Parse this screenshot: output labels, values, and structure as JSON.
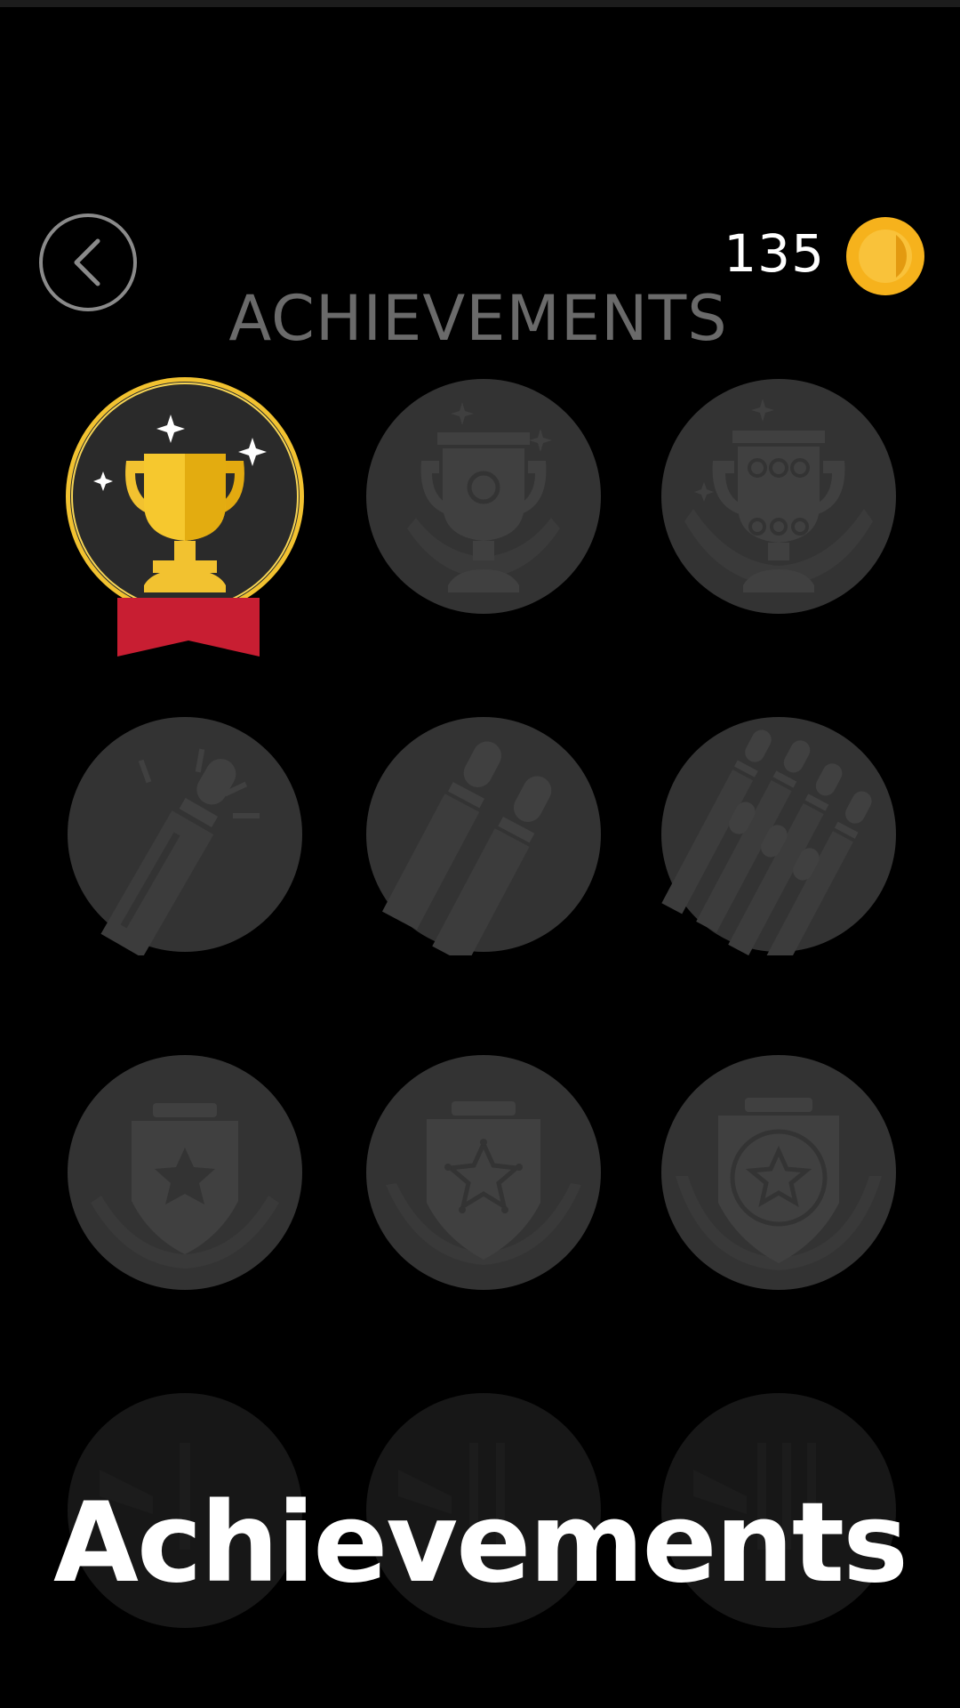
{
  "header": {
    "title": "ACHIEVEMENTS",
    "coins": "135",
    "back_icon": "chevron-left-icon",
    "coin_icon": "gold-coin-icon",
    "coin_color": "#f6b21c"
  },
  "achievements": [
    {
      "icon": "gold-trophy-icon",
      "state": "unlocked"
    },
    {
      "icon": "trophy-one-dot-icon",
      "state": "locked"
    },
    {
      "icon": "trophy-many-dots-icon",
      "state": "locked"
    },
    {
      "icon": "single-finger-icon",
      "state": "locked"
    },
    {
      "icon": "two-fingers-icon",
      "state": "locked"
    },
    {
      "icon": "many-fingers-icon",
      "state": "locked"
    },
    {
      "icon": "shield-star-icon",
      "state": "locked"
    },
    {
      "icon": "shield-star-outline-icon",
      "state": "locked"
    },
    {
      "icon": "shield-badge-star-icon",
      "state": "locked"
    },
    {
      "icon": "locked-badge-icon",
      "state": "locked"
    },
    {
      "icon": "locked-badge-icon",
      "state": "locked"
    },
    {
      "icon": "locked-badge-icon",
      "state": "locked"
    }
  ],
  "colors": {
    "background": "#000000",
    "locked_badge": "#333333",
    "locked_icon": "#404040",
    "unlocked_ring": "#f2c230",
    "ribbon": "#c81e32"
  },
  "caption": "Achievements"
}
